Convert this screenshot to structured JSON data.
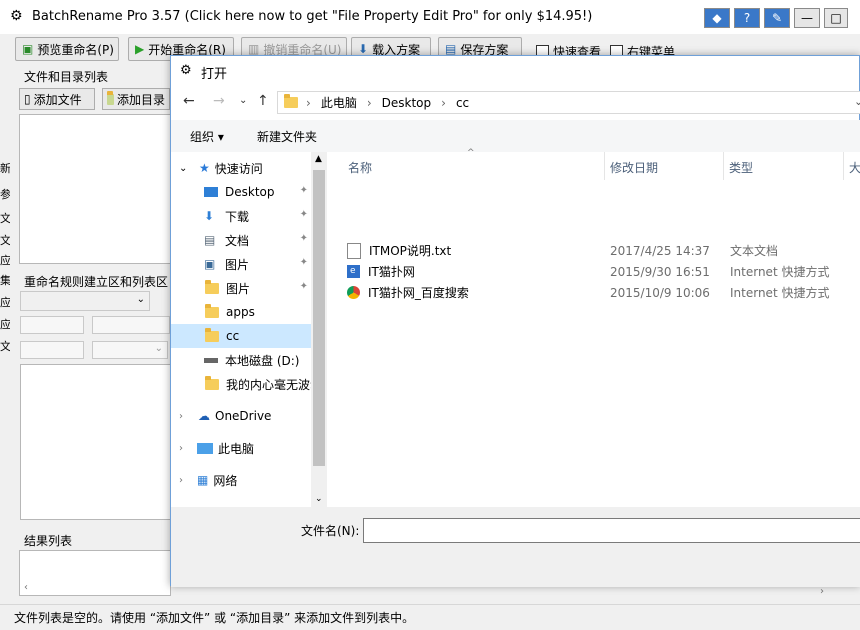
{
  "app": {
    "title": "BatchRename Pro 3.57  (Click here now to get \"File Property Edit Pro\" for only $14.95!)",
    "toolbar": {
      "preview": "预览重命名(P)",
      "start": "开始重命名(R)",
      "undo": "撤销重命名(U)",
      "load": "载入方案",
      "save": "保存方案",
      "quick_view": "快速查看",
      "right_menu": "右键菜单"
    },
    "files_group_label": "文件和目录列表",
    "add_file": "添加文件",
    "add_dir": "添加目录",
    "rules_group_label": "重命名规则建立区和列表区",
    "results_label": "结果列表",
    "left_cut_letters": [
      "新",
      "参",
      "文",
      "文",
      "应",
      "集",
      "应",
      "应",
      "文"
    ],
    "status_text": "文件列表是空的。请使用 “添加文件” 或 “添加目录” 来添加文件到列表中。"
  },
  "dialog": {
    "title": "打开",
    "breadcrumb": [
      "此电脑",
      "Desktop",
      "cc"
    ],
    "organize": "组织 ▾",
    "new_folder": "新建文件夹",
    "nav": {
      "quick_access": "快速访问",
      "items": [
        {
          "label": "Desktop",
          "icon": "desktop-icon",
          "pinned": true
        },
        {
          "label": "下载",
          "icon": "download-icon",
          "pinned": true
        },
        {
          "label": "文档",
          "icon": "document-icon",
          "pinned": true
        },
        {
          "label": "图片",
          "icon": "picture-icon",
          "pinned": true
        },
        {
          "label": "图片",
          "icon": "folder-icon",
          "pinned": true
        },
        {
          "label": "apps",
          "icon": "folder-icon",
          "pinned": false
        },
        {
          "label": "cc",
          "icon": "folder-icon",
          "pinned": false,
          "selected": true
        },
        {
          "label": "本地磁盘 (D:)",
          "icon": "drive-icon",
          "pinned": false
        },
        {
          "label": "我的内心毫无波动",
          "icon": "folder-icon",
          "pinned": false
        }
      ],
      "onedrive": "OneDrive",
      "this_pc": "此电脑",
      "network": "网络"
    },
    "columns": {
      "name": "名称",
      "date": "修改日期",
      "type": "类型",
      "size": "大"
    },
    "files": [
      {
        "name": "ITMOP说明.txt",
        "date": "2017/4/25 14:37",
        "type": "文本文档",
        "icon": "text-file-icon"
      },
      {
        "name": "IT猫扑网",
        "date": "2015/9/30 16:51",
        "type": "Internet 快捷方式",
        "icon": "ie-shortcut-icon"
      },
      {
        "name": "IT猫扑网_百度搜索",
        "date": "2015/10/9 10:06",
        "type": "Internet 快捷方式",
        "icon": "chrome-shortcut-icon"
      }
    ],
    "filename_label": "文件名(N):",
    "filename_value": ""
  }
}
